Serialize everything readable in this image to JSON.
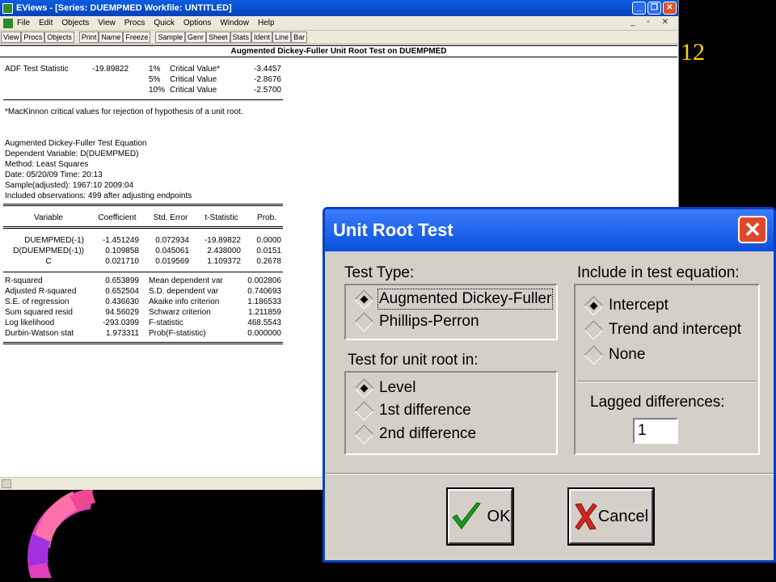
{
  "slide": {
    "number": "12"
  },
  "window": {
    "title": "EViews - [Series: DUEMPMED    Workfile: UNTITLED]",
    "buttons": {
      "minimize": "_",
      "maximize": "❐",
      "close": "✕"
    },
    "menu": [
      "File",
      "Edit",
      "Objects",
      "View",
      "Procs",
      "Quick",
      "Options",
      "Window",
      "Help"
    ],
    "mdi_buttons": "_ ▫ ✕",
    "toolbar": [
      "View",
      "Procs",
      "Objects",
      "Print",
      "Name",
      "Freeze",
      "Sample",
      "Genr",
      "Sheet",
      "Stats",
      "Ident",
      "Line",
      "Bar"
    ]
  },
  "output": {
    "header": "Augmented Dickey-Fuller Unit Root Test on DUEMPMED",
    "adf": {
      "label": "ADF Test Statistic",
      "value": "-19.89822",
      "critical": [
        {
          "level": "1%",
          "label": "Critical Value*",
          "value": "-3.4457"
        },
        {
          "level": "5%",
          "label": "Critical Value",
          "value": "-2.8676"
        },
        {
          "level": "10%",
          "label": "Critical Value",
          "value": "-2.5700"
        }
      ]
    },
    "footnote": "*MacKinnon critical values for rejection of hypothesis of a unit root.",
    "equation_info": [
      "Augmented Dickey-Fuller Test Equation",
      "Dependent Variable: D(DUEMPMED)",
      "Method: Least Squares",
      "Date: 05/20/09   Time: 20:13",
      "Sample(adjusted): 1967:10 2009:04",
      "Included observations: 499 after adjusting endpoints"
    ],
    "table_headers": [
      "Variable",
      "Coefficient",
      "Std. Error",
      "t-Statistic",
      "Prob."
    ],
    "rows": [
      [
        "DUEMPMED(-1)",
        "-1.451249",
        "0.072934",
        "-19.89822",
        "0.0000"
      ],
      [
        "D(DUEMPMED(-1))",
        "0.109858",
        "0.045061",
        "2.438000",
        "0.0151"
      ],
      [
        "C",
        "0.021710",
        "0.019569",
        "1.109372",
        "0.2678"
      ]
    ],
    "stats": [
      [
        "R-squared",
        "0.653899",
        "Mean dependent var",
        "0.002806"
      ],
      [
        "Adjusted R-squared",
        "0.652504",
        "S.D. dependent var",
        "0.740693"
      ],
      [
        "S.E. of regression",
        "0.436630",
        "Akaike info criterion",
        "1.186533"
      ],
      [
        "Sum squared resid",
        "94.56029",
        "Schwarz criterion",
        "1.211859"
      ],
      [
        "Log likelihood",
        "-293.0399",
        "F-statistic",
        "468.5543"
      ],
      [
        "Durbin-Watson stat",
        "1.973311",
        "Prob(F-statistic)",
        "0.000000"
      ]
    ]
  },
  "dialog": {
    "title": "Unit Root Test",
    "close": "✕",
    "test_type": {
      "label": "Test Type:",
      "options": [
        "Augmented Dickey-Fuller",
        "Phillips-Perron"
      ],
      "selected": "Augmented Dickey-Fuller"
    },
    "unit_root_in": {
      "label": "Test for unit root in:",
      "options": [
        "Level",
        "1st difference",
        "2nd difference"
      ],
      "selected": "Level"
    },
    "include": {
      "label": "Include in test equation:",
      "options": [
        "Intercept",
        "Trend and intercept",
        "None"
      ],
      "selected": "Intercept"
    },
    "lagged": {
      "label": "Lagged differences:",
      "value": "1"
    },
    "ok_label": "OK",
    "cancel_label": "Cancel",
    "colors": {
      "titlebar": "#0a4fdc",
      "ok_check": "#1a9a1a",
      "cancel_x": "#d0281e"
    }
  }
}
